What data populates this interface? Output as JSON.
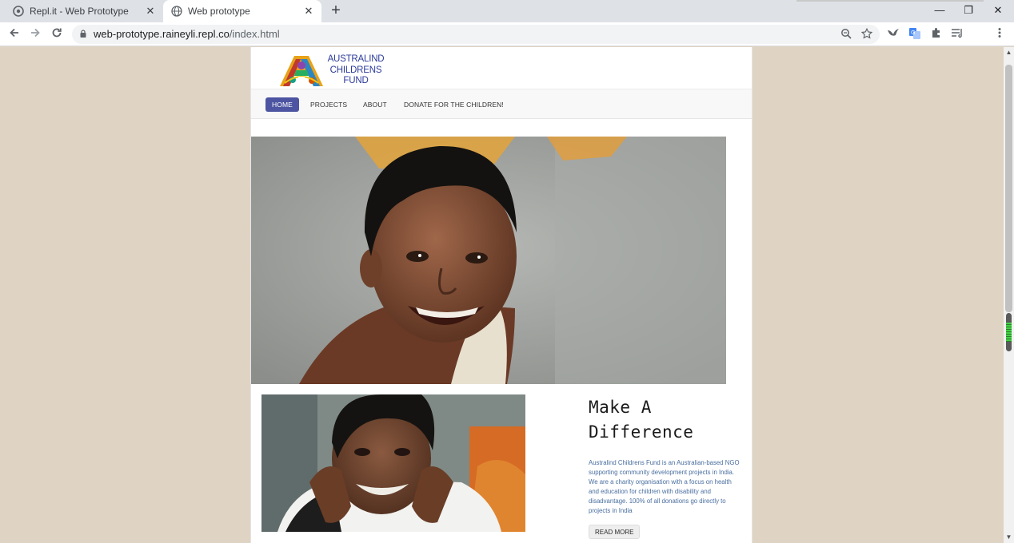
{
  "browser": {
    "tabs": [
      {
        "title": "Repl.it - Web Prototype",
        "active": false
      },
      {
        "title": "Web prototype",
        "active": true
      }
    ],
    "url_host": "web-prototype.raineyli.repl.co",
    "url_path": "/index.html",
    "icons": {
      "back": "arrow-left-icon",
      "forward": "arrow-right-icon",
      "reload": "reload-icon",
      "zoom": "magnifier-icon",
      "bookmark": "star-icon",
      "extensions": [
        "bird-extension-icon",
        "translate-extension-icon",
        "puzzle-extensions-icon",
        "reading-list-icon"
      ],
      "menu": "kebab-menu-icon"
    }
  },
  "site": {
    "logo": {
      "line1": "AUSTRALIND",
      "line2": "CHILDRENS",
      "line3": "FUND"
    },
    "nav": [
      {
        "label": "HOME",
        "active": true
      },
      {
        "label": "PROJECTS",
        "active": false
      },
      {
        "label": "ABOUT",
        "active": false
      },
      {
        "label": "DONATE FOR THE CHILDREN!",
        "active": false
      }
    ],
    "feature": {
      "headline_line1": "Make A",
      "headline_line2": "Difference",
      "body": "Australind Childrens Fund is an Australian-based NGO supporting community development projects in India. We are a charity organisation with a focus on health and education for children with disability and disadvantage. 100% of all donations go directly to projects in India",
      "button": "READ MORE"
    }
  },
  "colors": {
    "page_background": "#dfd4c4",
    "nav_active": "#4d55a2",
    "logo_text": "#2b3a9a",
    "body_text_link": "#4a6fa0"
  }
}
